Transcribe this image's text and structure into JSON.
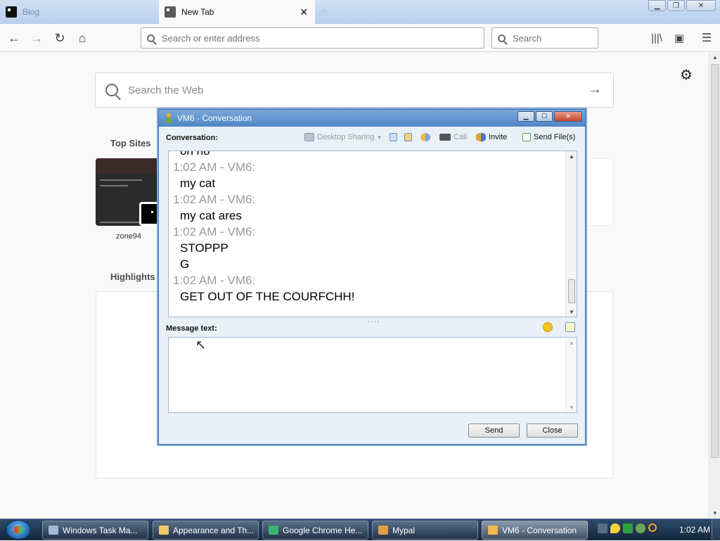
{
  "browser": {
    "tabs": [
      {
        "label": "Blog",
        "active": false
      },
      {
        "label": "New Tab",
        "active": true
      }
    ],
    "url_placeholder": "Search or enter address",
    "search_placeholder": "Search"
  },
  "newtab": {
    "web_search_placeholder": "Search the Web",
    "top_sites_title": "Top Sites",
    "top_sites": [
      {
        "label": "zone94"
      }
    ],
    "highlights_title": "Highlights"
  },
  "chat": {
    "title": "VM6 - Conversation",
    "conversation_label": "Conversation:",
    "toolbar": {
      "desktop_sharing": "Desktop Sharing",
      "call": "Call",
      "invite": "Invite",
      "send_files": "Send File(s)"
    },
    "messages": [
      {
        "type": "text",
        "value": "oh no"
      },
      {
        "type": "time",
        "value": "1:02 AM - VM6:"
      },
      {
        "type": "text",
        "value": "my cat"
      },
      {
        "type": "time",
        "value": "1:02 AM - VM6:"
      },
      {
        "type": "text",
        "value": "my cat ares"
      },
      {
        "type": "time",
        "value": "1:02 AM - VM6:"
      },
      {
        "type": "text",
        "value": "STOPPP"
      },
      {
        "type": "text",
        "value": "G"
      },
      {
        "type": "time",
        "value": "1:02 AM - VM6:"
      },
      {
        "type": "text",
        "value": "GET OUT OF THE COURFCHH!"
      }
    ],
    "message_text_label": "Message text:",
    "send_label": "Send",
    "close_label": "Close"
  },
  "taskbar": {
    "items": [
      {
        "label": "Windows Task Ma...",
        "active": false,
        "color": "#9fb9d6"
      },
      {
        "label": "Appearance and Th...",
        "active": false,
        "color": "#f0c96a"
      },
      {
        "label": "Google Chrome He...",
        "active": false,
        "color": "#3cb371"
      },
      {
        "label": "Mypal",
        "active": false,
        "color": "#e0a040"
      },
      {
        "label": "VM6 - Conversation",
        "active": true,
        "color": "#f2b84b"
      }
    ],
    "clock": "1:02 AM"
  },
  "colors": {
    "titlebar": "#4f86c6",
    "taskbar": "#15263d",
    "timestamp": "#9a9a9a"
  }
}
